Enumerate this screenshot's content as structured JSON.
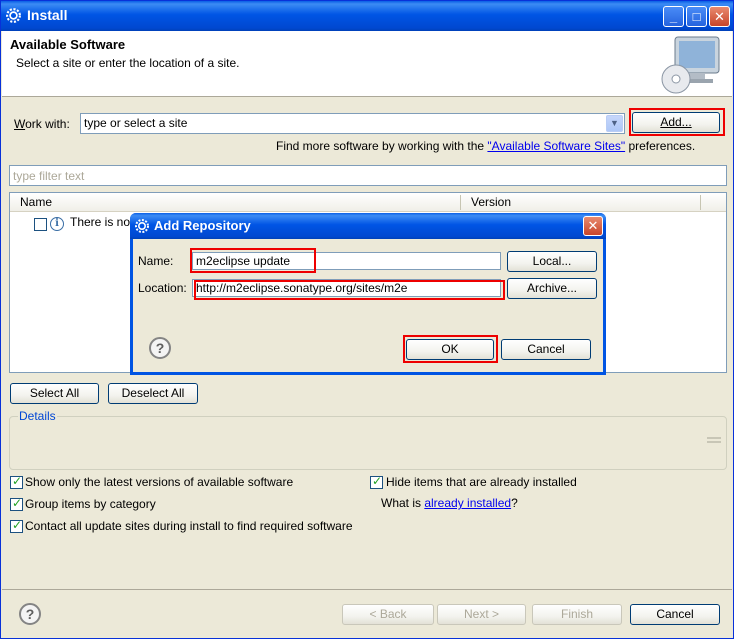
{
  "window": {
    "title": "Install",
    "controls": {
      "minimize": "_",
      "maximize": "□",
      "close": "✕"
    }
  },
  "header": {
    "title": "Available Software",
    "subtitle": "Select a site or enter the location of a site."
  },
  "work_with": {
    "label_mnemonic": "W",
    "label_rest": "ork with:",
    "value": "type or select a site",
    "add_button": "Add...",
    "find_more_prefix": "Find more software by working with the ",
    "find_more_link": "\"Available Software Sites\"",
    "find_more_suffix": " preferences."
  },
  "filter": {
    "placeholder": "type filter text"
  },
  "table": {
    "columns": [
      "Name",
      "Version"
    ],
    "rows": [
      {
        "text": "There is no"
      }
    ]
  },
  "selection_buttons": {
    "select_all": "Select All",
    "deselect_all": "Deselect All"
  },
  "details": {
    "label": "Details"
  },
  "options": {
    "latest_versions": {
      "label": "Show only the latest versions of available software",
      "checked": true
    },
    "group_by_category": {
      "label": "Group items by category",
      "checked": true
    },
    "contact_all_sites": {
      "label": "Contact all update sites during install to find required software",
      "checked": true
    },
    "hide_installed": {
      "label": "Hide items that are already installed",
      "checked": true
    },
    "what_is_prefix": "What is ",
    "what_is_link": "already installed",
    "what_is_suffix": "?"
  },
  "footer": {
    "back": "< Back",
    "next": "Next >",
    "finish": "Finish",
    "cancel": "Cancel"
  },
  "add_repository_dialog": {
    "title": "Add Repository",
    "name_label": "Name:",
    "name_value": "m2eclipse update",
    "location_label": "Location:",
    "location_value": "http://m2eclipse.sonatype.org/sites/m2e",
    "local_button": "Local...",
    "archive_button": "Archive...",
    "ok_button": "OK",
    "cancel_button": "Cancel",
    "close": "✕"
  },
  "colors": {
    "titlebar_blue": "#0055e5",
    "highlight_red": "#e00000",
    "link_blue": "#0000ee",
    "dialog_face": "#ece9d8"
  }
}
